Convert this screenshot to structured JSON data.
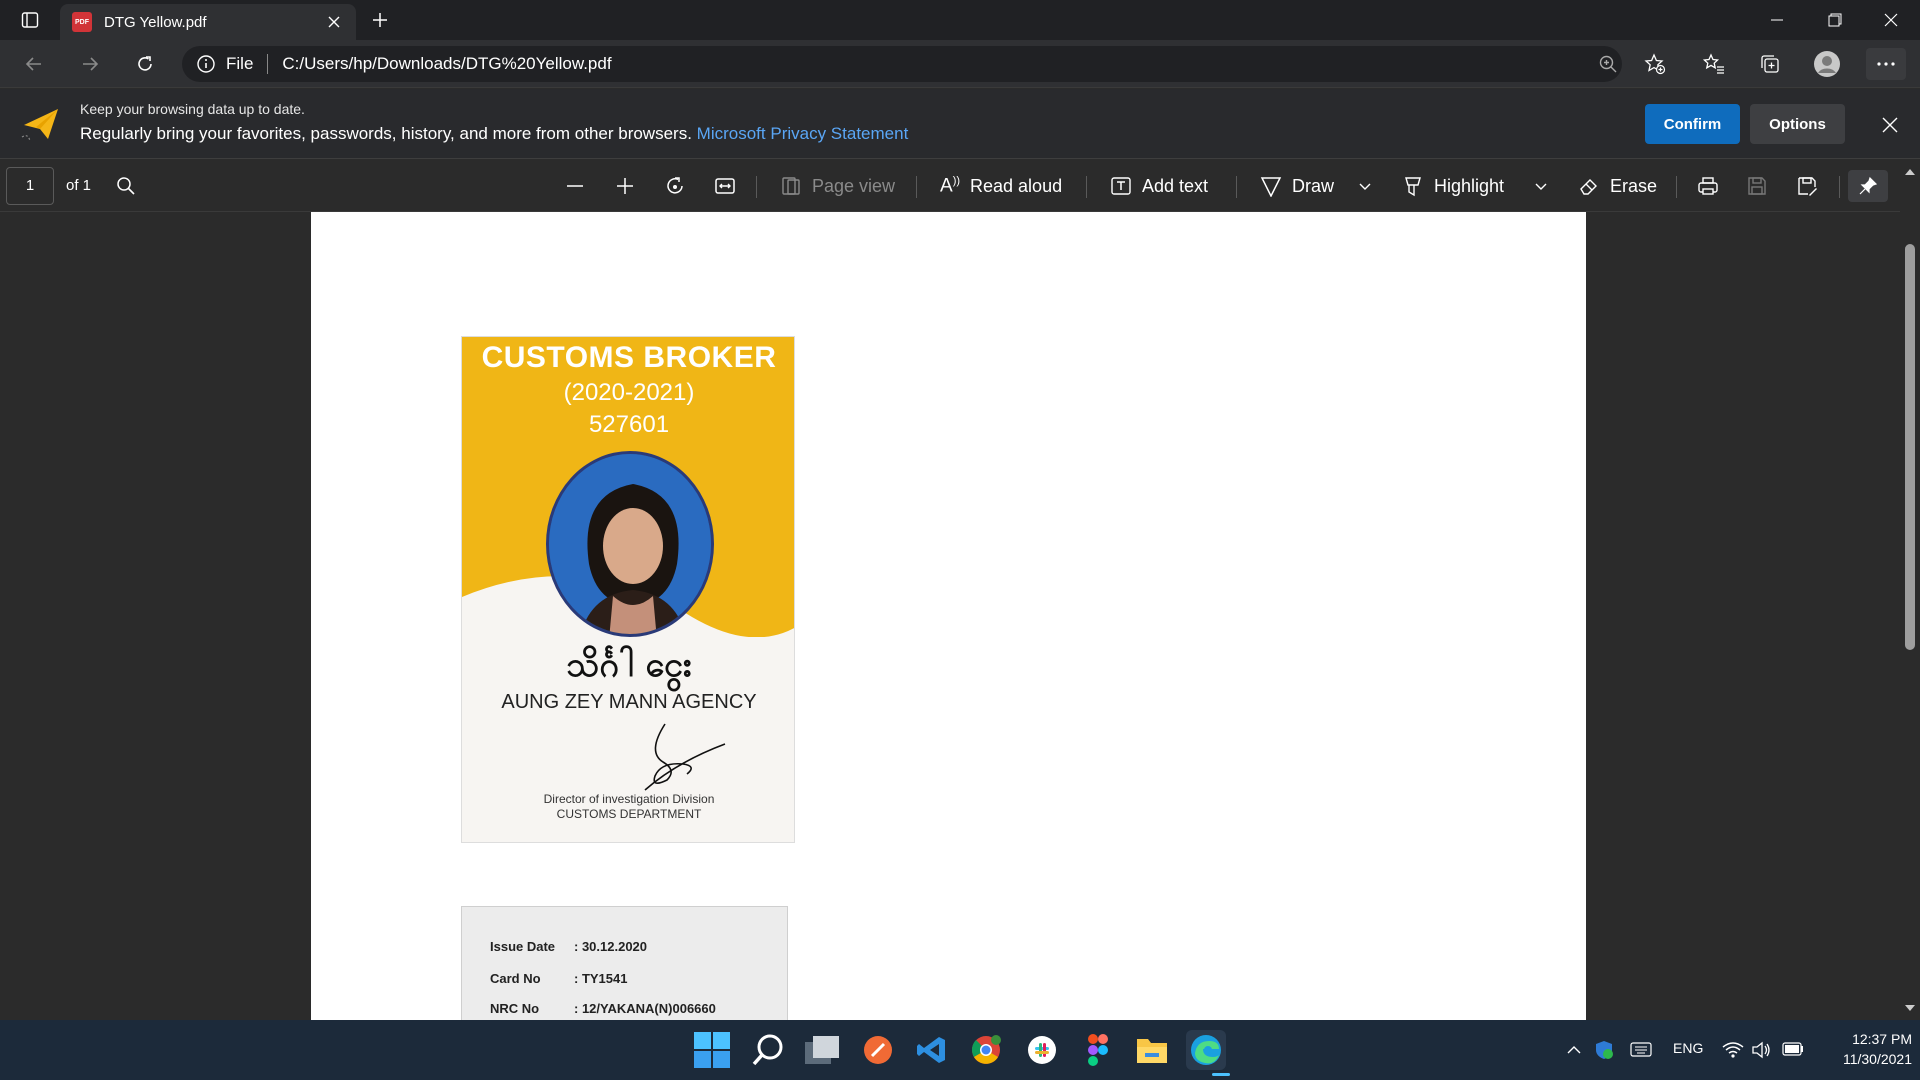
{
  "browser": {
    "tab_title": "DTG Yellow.pdf",
    "tab_icon": "pdf-icon",
    "address_scheme_label": "File",
    "address_url": "C:/Users/hp/Downloads/DTG%20Yellow.pdf"
  },
  "infobar": {
    "line1": "Keep your browsing data up to date.",
    "line2": "Regularly bring your favorites, passwords, history, and more from other browsers.",
    "link": "Microsoft Privacy Statement",
    "confirm": "Confirm",
    "options": "Options"
  },
  "pdf_toolbar": {
    "page_number": "1",
    "page_total": "of 1",
    "page_view": "Page view",
    "read_aloud": "Read aloud",
    "add_text": "Add text",
    "draw": "Draw",
    "highlight": "Highlight",
    "erase": "Erase"
  },
  "document": {
    "card": {
      "title": "CUSTOMS BROKER",
      "years": "(2020-2021)",
      "number": "527601",
      "name_myanmar": "သိင်္ဂါ ငွေး",
      "agency": "AUNG ZEY MANN AGENCY",
      "director_line1": "Director of investigation Division",
      "director_line2": "CUSTOMS DEPARTMENT"
    },
    "card_back": {
      "rows": [
        {
          "label": "Issue Date",
          "value": ": 30.12.2020"
        },
        {
          "label": "Card No",
          "value": ": TY1541"
        },
        {
          "label": "NRC No",
          "value": ": 12/YAKANA(N)006660"
        }
      ]
    }
  },
  "taskbar": {
    "language": "ENG",
    "time": "12:37 PM",
    "date": "11/30/2021"
  },
  "colors": {
    "accent": "#0f6cbd",
    "card_yellow": "#f0b616",
    "link": "#5aa6f5"
  }
}
